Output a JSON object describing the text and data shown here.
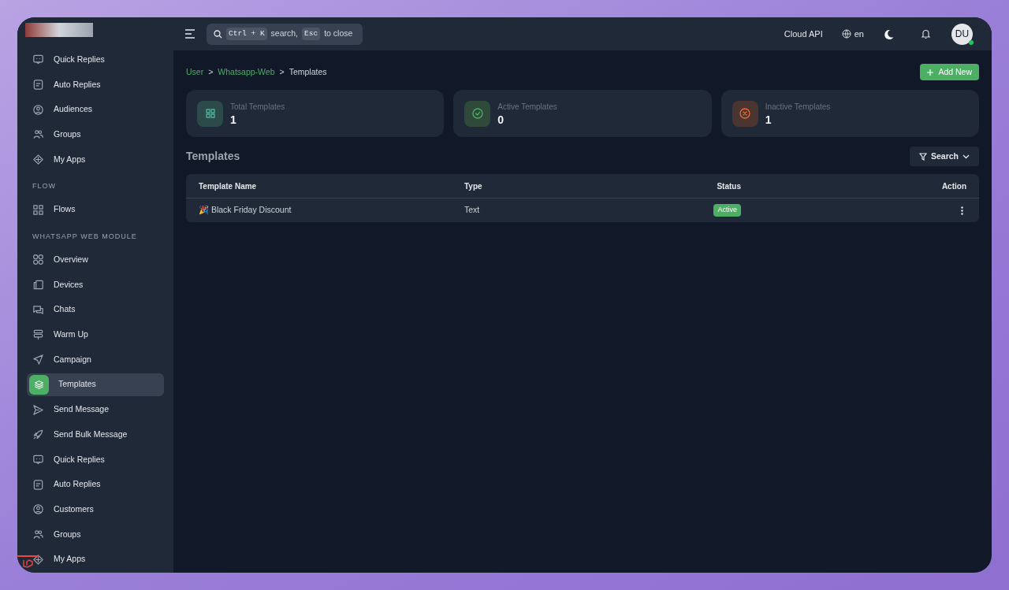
{
  "header": {
    "search": {
      "keys": [
        "Ctrl + K",
        "Esc"
      ],
      "texts": [
        "search,",
        "to close"
      ]
    },
    "links": [
      "Cloud API",
      "en"
    ],
    "avatar": {
      "initials": "DU",
      "online": true
    }
  },
  "sidebar": {
    "items": [
      {
        "kind": "item",
        "label": "Quick Replies",
        "selected": false
      },
      {
        "kind": "item",
        "label": "Auto Replies",
        "selected": false
      },
      {
        "kind": "item",
        "label": "Audiences",
        "selected": false
      },
      {
        "kind": "item",
        "label": "Groups",
        "selected": false
      },
      {
        "kind": "item",
        "label": "My Apps",
        "selected": false
      },
      {
        "kind": "section",
        "label": "FLOW"
      },
      {
        "kind": "item",
        "label": "Flows",
        "selected": false
      },
      {
        "kind": "section",
        "label": "WHATSAPP WEB MODULE"
      },
      {
        "kind": "item",
        "label": "Overview",
        "selected": false
      },
      {
        "kind": "item",
        "label": "Devices",
        "selected": false
      },
      {
        "kind": "item",
        "label": "Chats",
        "selected": false
      },
      {
        "kind": "item",
        "label": "Warm Up",
        "selected": false
      },
      {
        "kind": "item",
        "label": "Campaign",
        "selected": false
      },
      {
        "kind": "item",
        "label": "Templates",
        "selected": true
      },
      {
        "kind": "item",
        "label": "Send Message",
        "selected": false
      },
      {
        "kind": "item",
        "label": "Send Bulk Message",
        "selected": false
      },
      {
        "kind": "item",
        "label": "Quick Replies",
        "selected": false
      },
      {
        "kind": "item",
        "label": "Auto Replies",
        "selected": false
      },
      {
        "kind": "item",
        "label": "Customers",
        "selected": false
      },
      {
        "kind": "item",
        "label": "Groups",
        "selected": false
      },
      {
        "kind": "item",
        "label": "My Apps",
        "selected": false
      }
    ]
  },
  "breadcrumb_separator": ">",
  "breadcrumb": [
    {
      "label": "User",
      "link": true
    },
    {
      "label": "Whatsapp-Web",
      "link": true
    },
    {
      "label": "Templates",
      "link": false
    }
  ],
  "add_button": "Add New",
  "stats": [
    {
      "kind": "total",
      "label": "Total Templates",
      "value": "1"
    },
    {
      "kind": "active",
      "label": "Active Templates",
      "value": "0"
    },
    {
      "kind": "inactive",
      "label": "Inactive Templates",
      "value": "1"
    }
  ],
  "section_title": "Templates",
  "filter_button": "Search",
  "table": {
    "columns": [
      "Template Name",
      "Type",
      "Status",
      "Action"
    ],
    "rows": [
      {
        "name": "🎉 Black Friday Discount",
        "type": "Text",
        "status": "Active",
        "active": true
      }
    ]
  }
}
